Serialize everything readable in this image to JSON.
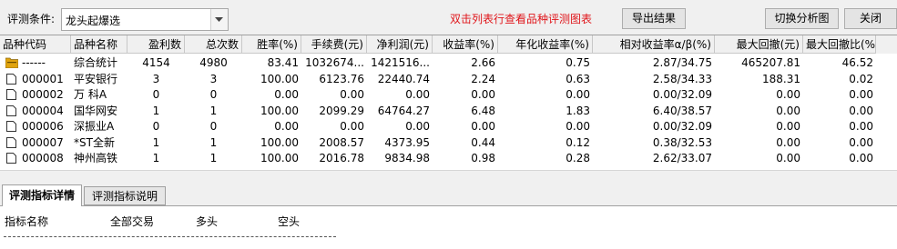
{
  "toolbar": {
    "condition_label": "评测条件:",
    "condition_value": "龙头起爆选",
    "hint": "双击列表行查看品种评测图表",
    "export_button": "导出结果",
    "switch_button": "切换分析图",
    "close_button": "关闭"
  },
  "colors": {
    "hint": "#e0161b",
    "folder_icon": "#e0a30e"
  },
  "grid": {
    "columns": [
      "品种代码",
      "品种名称",
      "盈利数",
      "总次数",
      "胜率(%)",
      "手续费(元)",
      "净利润(元)",
      "收益率(%)",
      "年化收益率(%)",
      "相对收益率α/β(%)",
      "最大回撤(元)",
      "最大回撤比(%)"
    ],
    "rows": [
      {
        "icon": "folder-icon",
        "code": "------",
        "name": "综合统计",
        "wins": "4154",
        "total": "4980",
        "winrate": "83.41",
        "fee": "1032674...",
        "profit": "1421516...",
        "ret": "2.66",
        "annual": "0.75",
        "rel": "2.87/34.75",
        "maxdd": "465207.81",
        "maxddr": "46.52"
      },
      {
        "icon": "document-icon",
        "code": "000001",
        "name": "平安银行",
        "wins": "3",
        "total": "3",
        "winrate": "100.00",
        "fee": "6123.76",
        "profit": "22440.74",
        "ret": "2.24",
        "annual": "0.63",
        "rel": "2.58/34.33",
        "maxdd": "188.31",
        "maxddr": "0.02"
      },
      {
        "icon": "document-icon",
        "code": "000002",
        "name": "万 科A",
        "wins": "0",
        "total": "0",
        "winrate": "0.00",
        "fee": "0.00",
        "profit": "0.00",
        "ret": "0.00",
        "annual": "0.00",
        "rel": "0.00/32.09",
        "maxdd": "0.00",
        "maxddr": "0.00"
      },
      {
        "icon": "document-icon",
        "code": "000004",
        "name": "国华网安",
        "wins": "1",
        "total": "1",
        "winrate": "100.00",
        "fee": "2099.29",
        "profit": "64764.27",
        "ret": "6.48",
        "annual": "1.83",
        "rel": "6.40/38.57",
        "maxdd": "0.00",
        "maxddr": "0.00"
      },
      {
        "icon": "document-icon",
        "code": "000006",
        "name": "深振业A",
        "wins": "0",
        "total": "0",
        "winrate": "0.00",
        "fee": "0.00",
        "profit": "0.00",
        "ret": "0.00",
        "annual": "0.00",
        "rel": "0.00/32.09",
        "maxdd": "0.00",
        "maxddr": "0.00"
      },
      {
        "icon": "document-icon",
        "code": "000007",
        "name": "*ST全新",
        "wins": "1",
        "total": "1",
        "winrate": "100.00",
        "fee": "2008.57",
        "profit": "4373.95",
        "ret": "0.44",
        "annual": "0.12",
        "rel": "0.38/32.53",
        "maxdd": "0.00",
        "maxddr": "0.00"
      },
      {
        "icon": "document-icon",
        "code": "000008",
        "name": "神州高铁",
        "wins": "1",
        "total": "1",
        "winrate": "100.00",
        "fee": "2016.78",
        "profit": "9834.98",
        "ret": "0.98",
        "annual": "0.28",
        "rel": "2.62/33.07",
        "maxdd": "0.00",
        "maxddr": "0.00"
      }
    ]
  },
  "tabs": [
    {
      "label": "评测指标详情",
      "active": true
    },
    {
      "label": "评测指标说明",
      "active": false
    }
  ],
  "detail": {
    "headers": [
      "指标名称",
      "全部交易",
      "多头",
      "空头"
    ]
  }
}
